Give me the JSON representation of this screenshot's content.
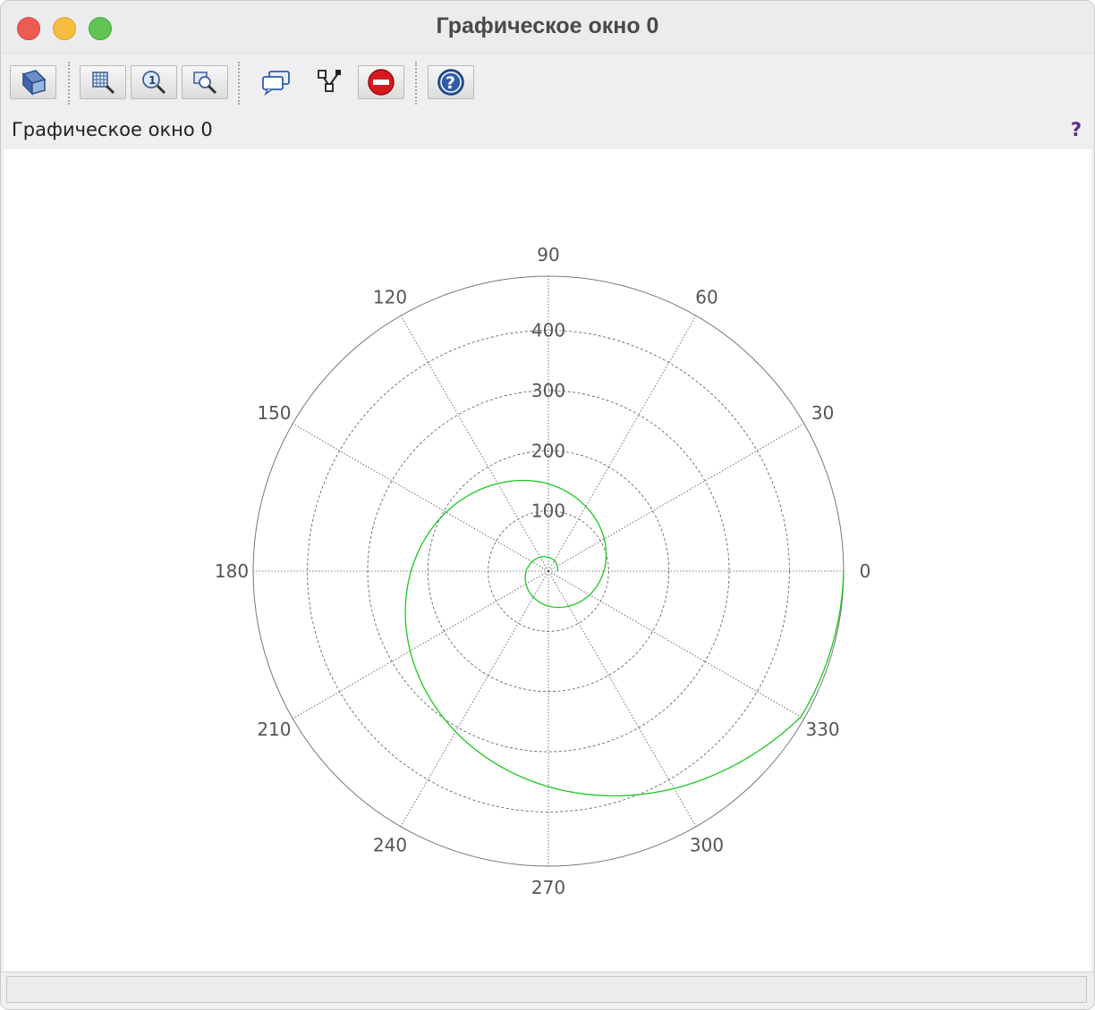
{
  "window": {
    "title": "Графическое окно 0"
  },
  "toolbar": {
    "buttons": [
      {
        "icon": "rotate-icon"
      },
      {
        "icon": "zoom-in-icon"
      },
      {
        "icon": "zoom-original-icon"
      },
      {
        "icon": "zoom-area-icon"
      },
      {
        "icon": "datatip-icon"
      },
      {
        "icon": "graph-editor-icon"
      },
      {
        "icon": "stop-icon"
      },
      {
        "icon": "help-icon"
      }
    ]
  },
  "figure": {
    "label": "Графическое окно 0",
    "help_glyph": "?"
  },
  "colors": {
    "curve": "#19c81f",
    "grid": "#555555",
    "stop": "#d71920",
    "help": "#2e5ca8"
  },
  "chart_data": {
    "type": "polar-line",
    "rmax": 490,
    "r_ticks": [
      "100",
      "200",
      "300",
      "400"
    ],
    "r_tick_values": [
      100,
      200,
      300,
      400
    ],
    "theta_ticks": [
      "0",
      "30",
      "60",
      "90",
      "120",
      "150",
      "180",
      "210",
      "240",
      "270",
      "300",
      "330"
    ],
    "theta_tick_values": [
      0,
      30,
      60,
      90,
      120,
      150,
      180,
      210,
      240,
      270,
      300,
      330
    ],
    "series": [
      {
        "curve": "exponential spiral",
        "color": "#19c81f",
        "theta_deg": [
          0,
          30,
          60,
          90,
          120,
          150,
          180,
          210,
          240,
          270,
          300,
          330,
          360,
          390,
          420,
          450,
          480,
          510,
          540,
          570,
          600,
          630,
          660,
          690,
          720
        ],
        "r": [
          15,
          17,
          20,
          23,
          27,
          31,
          37,
          43,
          50,
          58,
          67,
          79,
          92,
          107,
          124,
          145,
          168,
          196,
          228,
          265,
          308,
          358,
          417,
          484,
          490
        ]
      }
    ],
    "grid": true
  }
}
